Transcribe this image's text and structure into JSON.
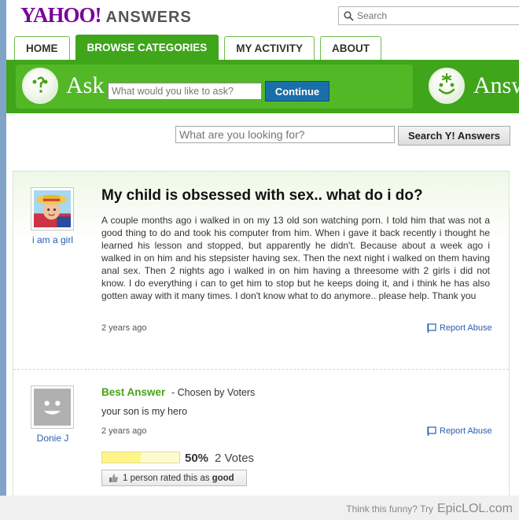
{
  "header": {
    "logo_yahoo": "YAHOO!",
    "logo_answers": "ANSWERS",
    "search_placeholder": "Search"
  },
  "nav": {
    "tabs": [
      {
        "label": "HOME",
        "active": false
      },
      {
        "label": "BROWSE CATEGORIES",
        "active": true
      },
      {
        "label": "MY ACTIVITY",
        "active": false
      },
      {
        "label": "ABOUT",
        "active": false
      }
    ]
  },
  "ask_bar": {
    "ask_label": "Ask",
    "ask_placeholder": "What would you like to ask?",
    "continue_label": "Continue",
    "answer_label": "Answ"
  },
  "search_bar": {
    "placeholder": "What are you looking for?",
    "button_label": "Search Y! Answers"
  },
  "question": {
    "title": "My child is obsessed with sex.. what do i do?",
    "body": "A couple months ago i walked in on my 13 old son watching porn. I told him that was not a good thing to do and took his computer from him. When i gave it back recently i thought he learned his lesson and stopped, but apparently he didn't. Because about a week ago i walked in on him and his stepsister having sex. Then the next night i walked on them having anal sex. Then 2 nights ago i walked in on him having a threesome with 2 girls i did not know. I do everything i can to get him to stop but he keeps doing it, and i think he has also gotten away with it many times. I don't know what to do anymore.. please help. Thank you",
    "time": "2 years ago",
    "author": "i am a girl",
    "report_label": "Report Abuse"
  },
  "best_answer": {
    "label": "Best Answer",
    "chosen_by": "- Chosen by Voters",
    "text": "your son is my hero",
    "time": "2 years ago",
    "author": "Donie J",
    "report_label": "Report Abuse",
    "vote_percent": "50%",
    "vote_fraction": 0.5,
    "vote_count": "2 Votes",
    "rated_prefix": "1 person rated this as",
    "rated_value": "good"
  },
  "footer": {
    "prompt": "Think this funny? Try",
    "brand": "EpicLOL.com"
  },
  "colors": {
    "brand_purple": "#7b0099",
    "nav_green": "#3fa51b",
    "link_blue": "#2a5db0",
    "button_blue": "#1b6fa8",
    "best_answer_green": "#4aa218"
  }
}
